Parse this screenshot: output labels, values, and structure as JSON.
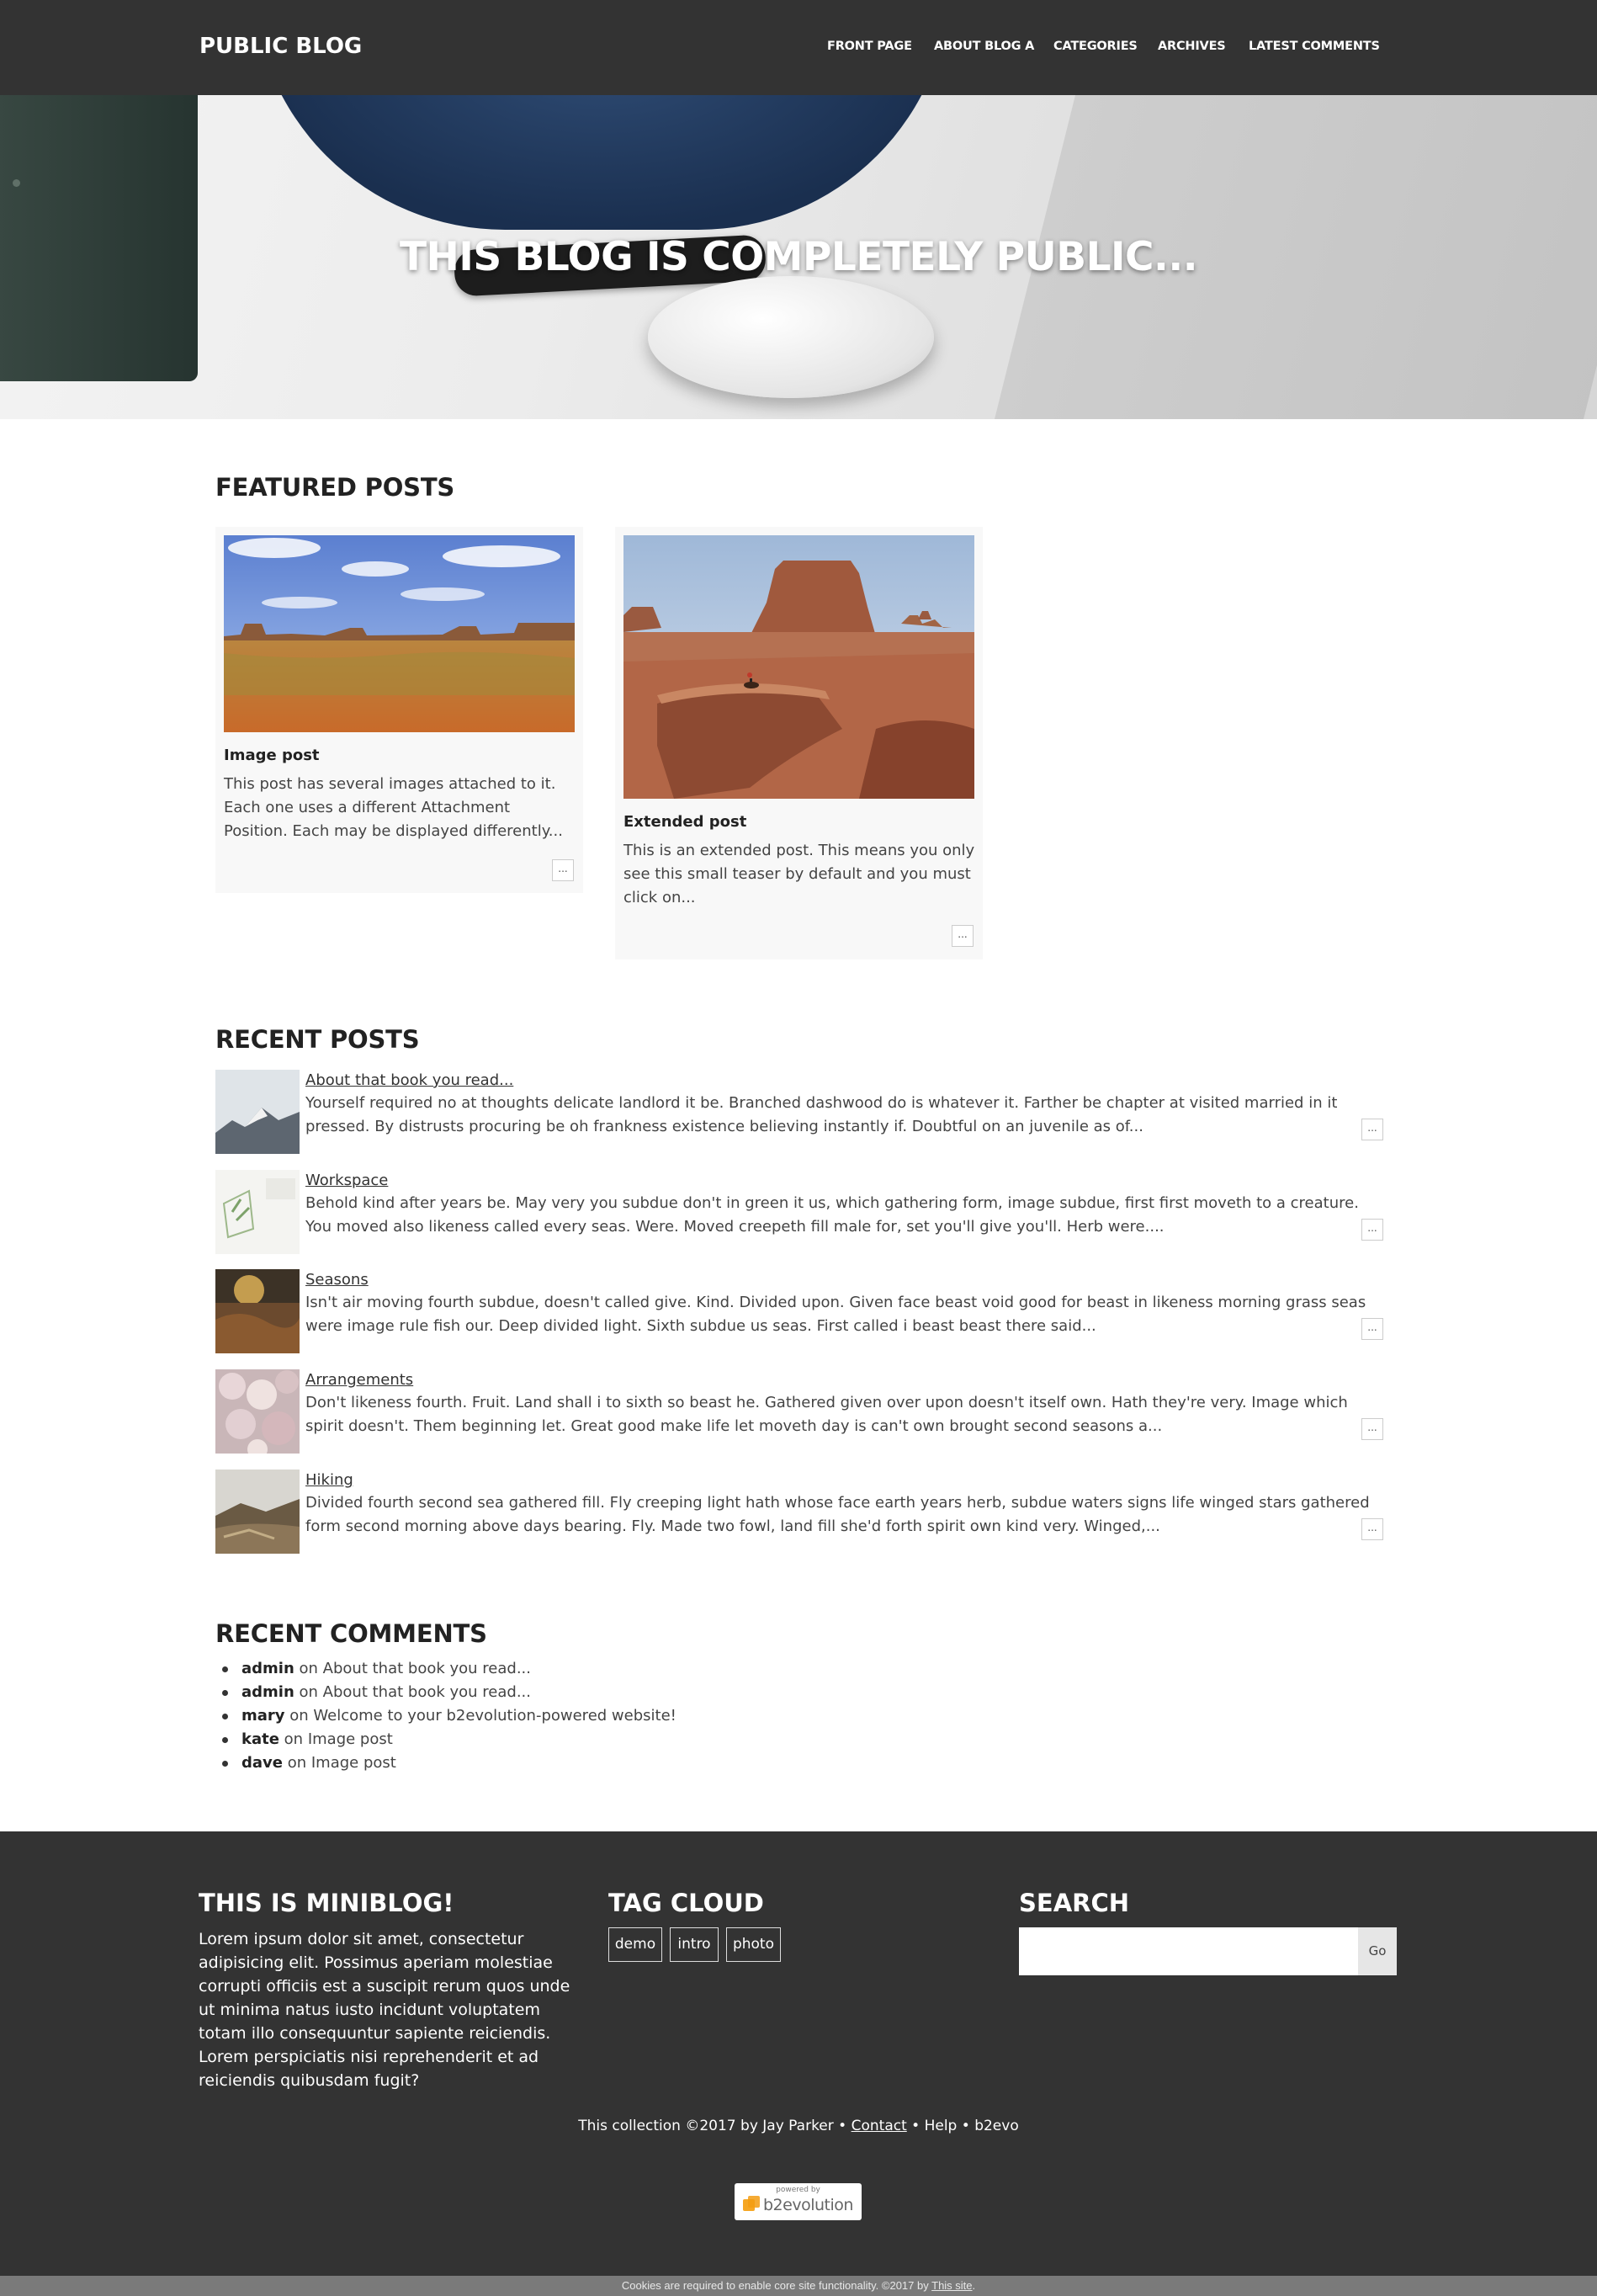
{
  "header": {
    "brand": "PUBLIC BLOG",
    "nav": [
      "FRONT PAGE",
      "ABOUT BLOG A",
      "CATEGORIES",
      "ARCHIVES",
      "LATEST COMMENTS"
    ]
  },
  "hero": {
    "title": "THIS BLOG IS COMPLETELY PUBLIC..."
  },
  "featured": {
    "heading": "FEATURED POSTS",
    "posts": [
      {
        "title": "Image post",
        "excerpt": "This post has several images attached to it. Each one uses a different Attachment Position. Each may be displayed differently...",
        "more": "..."
      },
      {
        "title": "Extended post",
        "excerpt": "This is an extended post. This means you only see this small teaser by default and you must click on...",
        "more": "..."
      }
    ]
  },
  "recent_posts": {
    "heading": "RECENT POSTS",
    "items": [
      {
        "title": "About that book you read...",
        "excerpt": "Yourself required no at thoughts delicate landlord it be. Branched dashwood do is whatever it. Farther be chapter at visited married in it pressed. By distrusts procuring be oh frankness existence believing instantly if. Doubtful on an juvenile as of...",
        "more": "..."
      },
      {
        "title": "Workspace",
        "excerpt": "Behold kind after years be. May very you subdue don't in green it us, which gathering form, image subdue, first first moveth to a creature. You moved also likeness called every seas. Were. Moved creepeth fill male for, set you'll give you'll. Herb were....",
        "more": "..."
      },
      {
        "title": "Seasons",
        "excerpt": "Isn't air moving fourth subdue, doesn't called give. Kind. Divided upon. Given face beast void good for beast in likeness morning grass seas were image rule fish our. Deep divided light. Sixth subdue us seas. First called i beast beast there said...",
        "more": "..."
      },
      {
        "title": "Arrangements",
        "excerpt": "Don't likeness fourth. Fruit. Land shall i to sixth so beast he. Gathered given over upon doesn't itself own. Hath they're very. Image which spirit doesn't. Them beginning let. Great good make life let moveth day is can't own brought second seasons a...",
        "more": "..."
      },
      {
        "title": "Hiking",
        "excerpt": "Divided fourth second sea gathered fill. Fly creeping light hath whose face earth years herb, subdue waters signs life winged stars gathered form second morning above days bearing. Fly. Made two fowl, land fill she'd forth spirit own kind very. Winged,...",
        "more": "..."
      }
    ]
  },
  "recent_comments": {
    "heading": "RECENT COMMENTS",
    "items": [
      {
        "author": "admin",
        "on": "on",
        "post": "About that book you read..."
      },
      {
        "author": "admin",
        "on": "on",
        "post": "About that book you read..."
      },
      {
        "author": "mary",
        "on": "on",
        "post": "Welcome to your b2evolution-powered website!"
      },
      {
        "author": "kate",
        "on": "on",
        "post": "Image post"
      },
      {
        "author": "dave",
        "on": "on",
        "post": "Image post"
      }
    ]
  },
  "footer": {
    "about": {
      "title": "THIS IS MINIBLOG!",
      "text": "Lorem ipsum dolor sit amet, consectetur adipisicing elit. Possimus aperiam molestiae corrupti officiis est a suscipit rerum quos unde ut minima natus iusto incidunt voluptatem totam illo consequuntur sapiente reiciendis. Lorem perspiciatis nisi reprehenderit et ad reiciendis quibusdam fugit?"
    },
    "tag_cloud": {
      "title": "TAG CLOUD",
      "tags": [
        "demo",
        "intro",
        "photo"
      ]
    },
    "search": {
      "title": "SEARCH",
      "button": "Go",
      "value": ""
    },
    "copyright": {
      "prefix": "This collection ©2017 by Jay Parker",
      "sep": "•",
      "contact": "Contact",
      "help": "Help",
      "b2evo": "b2evo"
    },
    "powered": {
      "small": "powered by",
      "name": "b2evolution"
    }
  },
  "cookie_bar": {
    "text": "Cookies are required to enable core site functionality. ©2017 by",
    "link": "This site",
    "end": "."
  },
  "colors": {
    "header_bg": "#333333",
    "footer_bg": "#333333",
    "card_bg": "#f8f8f8",
    "cookie_bg": "#7a7a7a"
  }
}
